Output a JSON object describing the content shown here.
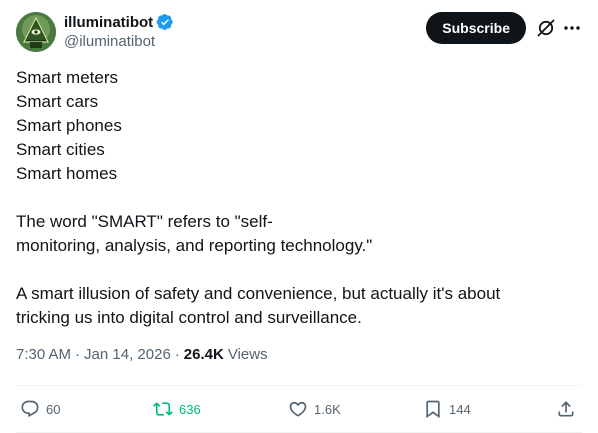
{
  "author": {
    "display_name": "illuminatibot",
    "handle": "@iluminatibot",
    "verified": true,
    "avatar_icon": "pyramid-eye-icon"
  },
  "header": {
    "subscribe_label": "Subscribe",
    "grok_icon": "grok-icon",
    "more_icon": "more-icon"
  },
  "tweet": {
    "lines": [
      "Smart meters",
      "Smart cars",
      "Smart phones",
      "Smart cities",
      "Smart homes"
    ],
    "paragraph_2_line_1": "The word \"SMART\" refers to \"self-",
    "paragraph_2_line_2": "monitoring, analysis, and reporting technology.\"",
    "paragraph_3_line_1": "A smart illusion of safety and convenience, but actually it's about",
    "paragraph_3_line_2": "tricking us into digital control and surveillance."
  },
  "meta": {
    "time": "7:30 AM",
    "date": "Jan 14, 2026",
    "separator": "·",
    "views_count": "26.4K",
    "views_label": "Views"
  },
  "actions": {
    "reply_count": "60",
    "repost_count": "636",
    "like_count": "1.6K",
    "bookmark_count": "144"
  },
  "colors": {
    "text_primary": "#0f1419",
    "text_secondary": "#536471",
    "verified_blue": "#1d9bf0",
    "repost_green": "#00ba7c",
    "divider": "#eff3f4",
    "subscribe_bg": "#0f1419"
  }
}
